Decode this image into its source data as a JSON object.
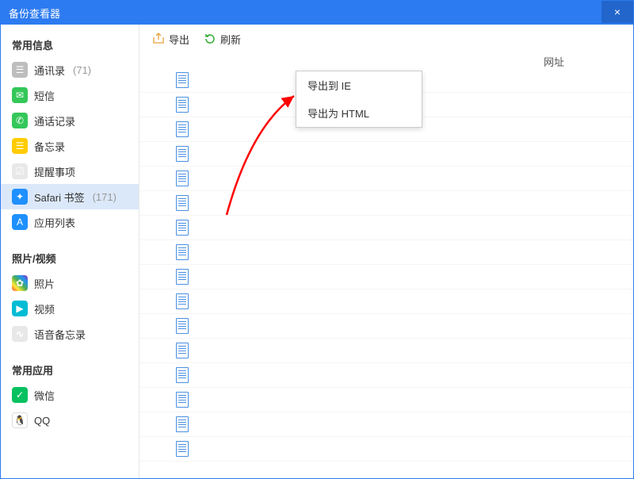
{
  "window": {
    "title": "备份查看器",
    "close_glyph": "×"
  },
  "toolbar": {
    "export_label": "导出",
    "refresh_label": "刷新"
  },
  "export_menu": {
    "items": [
      {
        "label": "导出到 IE"
      },
      {
        "label": "导出为 HTML"
      }
    ]
  },
  "columns": {
    "url_label": "网址"
  },
  "sidebar": {
    "groups": [
      {
        "title": "常用信息",
        "items": [
          {
            "key": "contacts",
            "label": "通讯录",
            "count": "(71)"
          },
          {
            "key": "sms",
            "label": "短信",
            "count": ""
          },
          {
            "key": "calls",
            "label": "通话记录",
            "count": ""
          },
          {
            "key": "notes",
            "label": "备忘录",
            "count": ""
          },
          {
            "key": "reminders",
            "label": "提醒事项",
            "count": ""
          },
          {
            "key": "safari",
            "label": "Safari 书签",
            "count": "(171)",
            "selected": true
          },
          {
            "key": "apps",
            "label": "应用列表",
            "count": ""
          }
        ]
      },
      {
        "title": "照片/视频",
        "items": [
          {
            "key": "photos",
            "label": "照片",
            "count": ""
          },
          {
            "key": "videos",
            "label": "视频",
            "count": ""
          },
          {
            "key": "voice",
            "label": "语音备忘录",
            "count": ""
          }
        ]
      },
      {
        "title": "常用应用",
        "items": [
          {
            "key": "wechat",
            "label": "微信",
            "count": ""
          },
          {
            "key": "qq",
            "label": "QQ",
            "count": ""
          }
        ]
      }
    ]
  },
  "list": {
    "row_count": 16
  },
  "colors": {
    "accent": "#2d7bf0",
    "arrow": "#ff0000"
  }
}
